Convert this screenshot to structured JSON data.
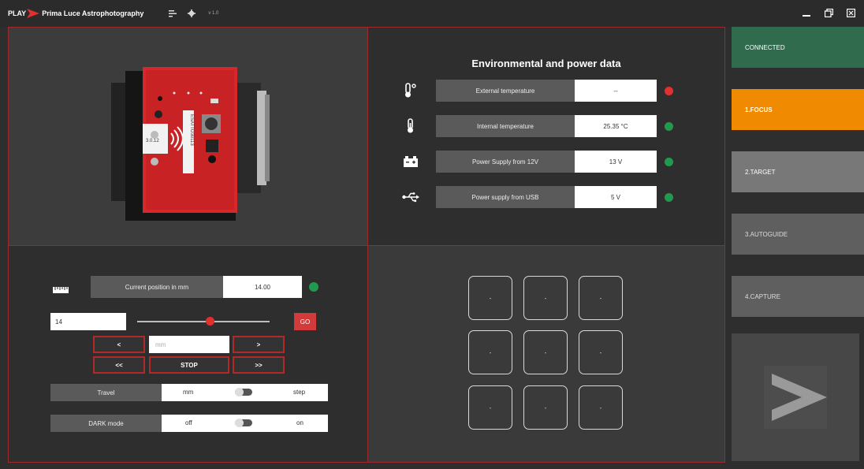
{
  "titlebar": {
    "play": "PLAY",
    "brand": "Prima Luce Astrophotography",
    "version": "v 1.0",
    "menu_icon": "list-icon",
    "settings_icon": "gear-icon",
    "minimize_icon": "minimize-icon",
    "restore_icon": "restore-icon",
    "close_icon": "close-icon"
  },
  "camera": {
    "firmware": "3.0.12",
    "serial": "ESATTO30113"
  },
  "env": {
    "title": "Environmental and power data",
    "rows": [
      {
        "icon": "thermometer-ext-icon",
        "label": "External temperature",
        "value": "--",
        "status_color": "#e0312f"
      },
      {
        "icon": "thermometer-int-icon",
        "label": "Internal temperature",
        "value": "25.35 °C",
        "status_color": "#1f9a4f"
      },
      {
        "icon": "battery-icon",
        "label": "Power Supply from 12V",
        "value": "13 V",
        "status_color": "#1f9a4f"
      },
      {
        "icon": "usb-icon",
        "label": "Power supply from USB",
        "value": "5 V",
        "status_color": "#1f9a4f"
      }
    ]
  },
  "focus": {
    "ruler_icon": "ruler-icon",
    "position_label": "Current position in mm",
    "position_value": "14.00",
    "position_status_color": "#1f9a4f",
    "target_input": "14",
    "slider_fraction": 0.55,
    "go_label": "GO",
    "step_back_label": "<",
    "step_fwd_label": ">",
    "mm_placeholder": "mm",
    "fast_back_label": "<<",
    "fast_fwd_label": ">>",
    "stop_label": "STOP",
    "travel_label": "Travel",
    "travel_left": "mm",
    "travel_right": "step",
    "dark_label": "DARK mode",
    "dark_left": "off",
    "dark_right": "on"
  },
  "grid": {
    "tiles": [
      "-",
      "-",
      "-",
      "-",
      "-",
      "-",
      "-",
      "-",
      "-"
    ]
  },
  "nav": {
    "connected": "CONNECTED",
    "focus": "1.FOCUS",
    "target": "2.TARGET",
    "autoguide": "3.AUTOGUIDE",
    "capture": "4.CAPTURE",
    "next_icon": "next-chevron-icon"
  },
  "colors": {
    "accent_red": "#b02a2a",
    "connected_green": "#2f6b4c",
    "active_orange": "#f08a00"
  }
}
